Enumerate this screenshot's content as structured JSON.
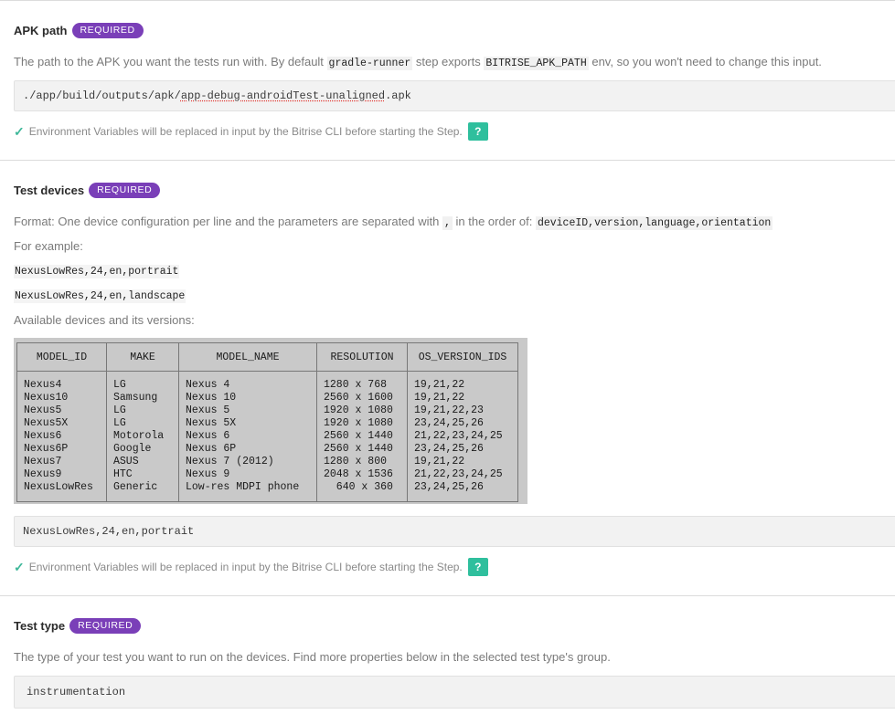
{
  "apk": {
    "title": "APK path",
    "badge": "REQUIRED",
    "desc_prefix": "The path to the APK you want the tests run with. By default ",
    "code1": "gradle-runner",
    "desc_mid": " step exports ",
    "code2": "BITRISE_APK_PATH",
    "desc_suffix": " env, so you won't need to change this input.",
    "value_plain": "./app/build/outputs/apk/",
    "value_spell": "app-debug-androidTest-unaligned",
    "value_end": ".apk",
    "env_note": "Environment Variables will be replaced in input by the Bitrise CLI before starting the Step.",
    "help": "?"
  },
  "devices": {
    "title": "Test devices",
    "badge": "REQUIRED",
    "format_prefix": "Format: One device configuration per line and the parameters are separated with ",
    "format_sep": ",",
    "format_mid": " in the order of: ",
    "format_code": "deviceID,version,language,orientation",
    "example_label": "For example:",
    "example1": "NexusLowRes,24,en,portrait",
    "example2": "NexusLowRes,24,en,landscape",
    "available_label": "Available devices and its versions:",
    "table_headers": [
      "MODEL_ID",
      "MAKE",
      "MODEL_NAME",
      "RESOLUTION",
      "OS_VERSION_IDS"
    ],
    "table_rows": [
      [
        "Nexus4",
        "LG",
        "Nexus 4",
        "1280 x 768",
        "19,21,22"
      ],
      [
        "Nexus10",
        "Samsung",
        "Nexus 10",
        "2560 x 1600",
        "19,21,22"
      ],
      [
        "Nexus5",
        "LG",
        "Nexus 5",
        "1920 x 1080",
        "19,21,22,23"
      ],
      [
        "Nexus5X",
        "LG",
        "Nexus 5X",
        "1920 x 1080",
        "23,24,25,26"
      ],
      [
        "Nexus6",
        "Motorola",
        "Nexus 6",
        "2560 x 1440",
        "21,22,23,24,25"
      ],
      [
        "Nexus6P",
        "Google",
        "Nexus 6P",
        "2560 x 1440",
        "23,24,25,26"
      ],
      [
        "Nexus7",
        "ASUS",
        "Nexus 7 (2012)",
        "1280 x 800",
        "19,21,22"
      ],
      [
        "Nexus9",
        "HTC",
        "Nexus 9",
        "2048 x 1536",
        "21,22,23,24,25"
      ],
      [
        "NexusLowRes",
        "Generic",
        "Low-res MDPI phone",
        "  640 x 360",
        "23,24,25,26"
      ]
    ],
    "value": "NexusLowRes,24,en,portrait",
    "env_note": "Environment Variables will be replaced in input by the Bitrise CLI before starting the Step.",
    "help": "?"
  },
  "test_type": {
    "title": "Test type",
    "badge": "REQUIRED",
    "desc": "The type of your test you want to run on the devices. Find more properties below in the selected test type's group.",
    "value": "instrumentation"
  },
  "colors": {
    "badge": "#7a3fb8",
    "help_button": "#2fbf9d",
    "check": "#3fb89a"
  }
}
